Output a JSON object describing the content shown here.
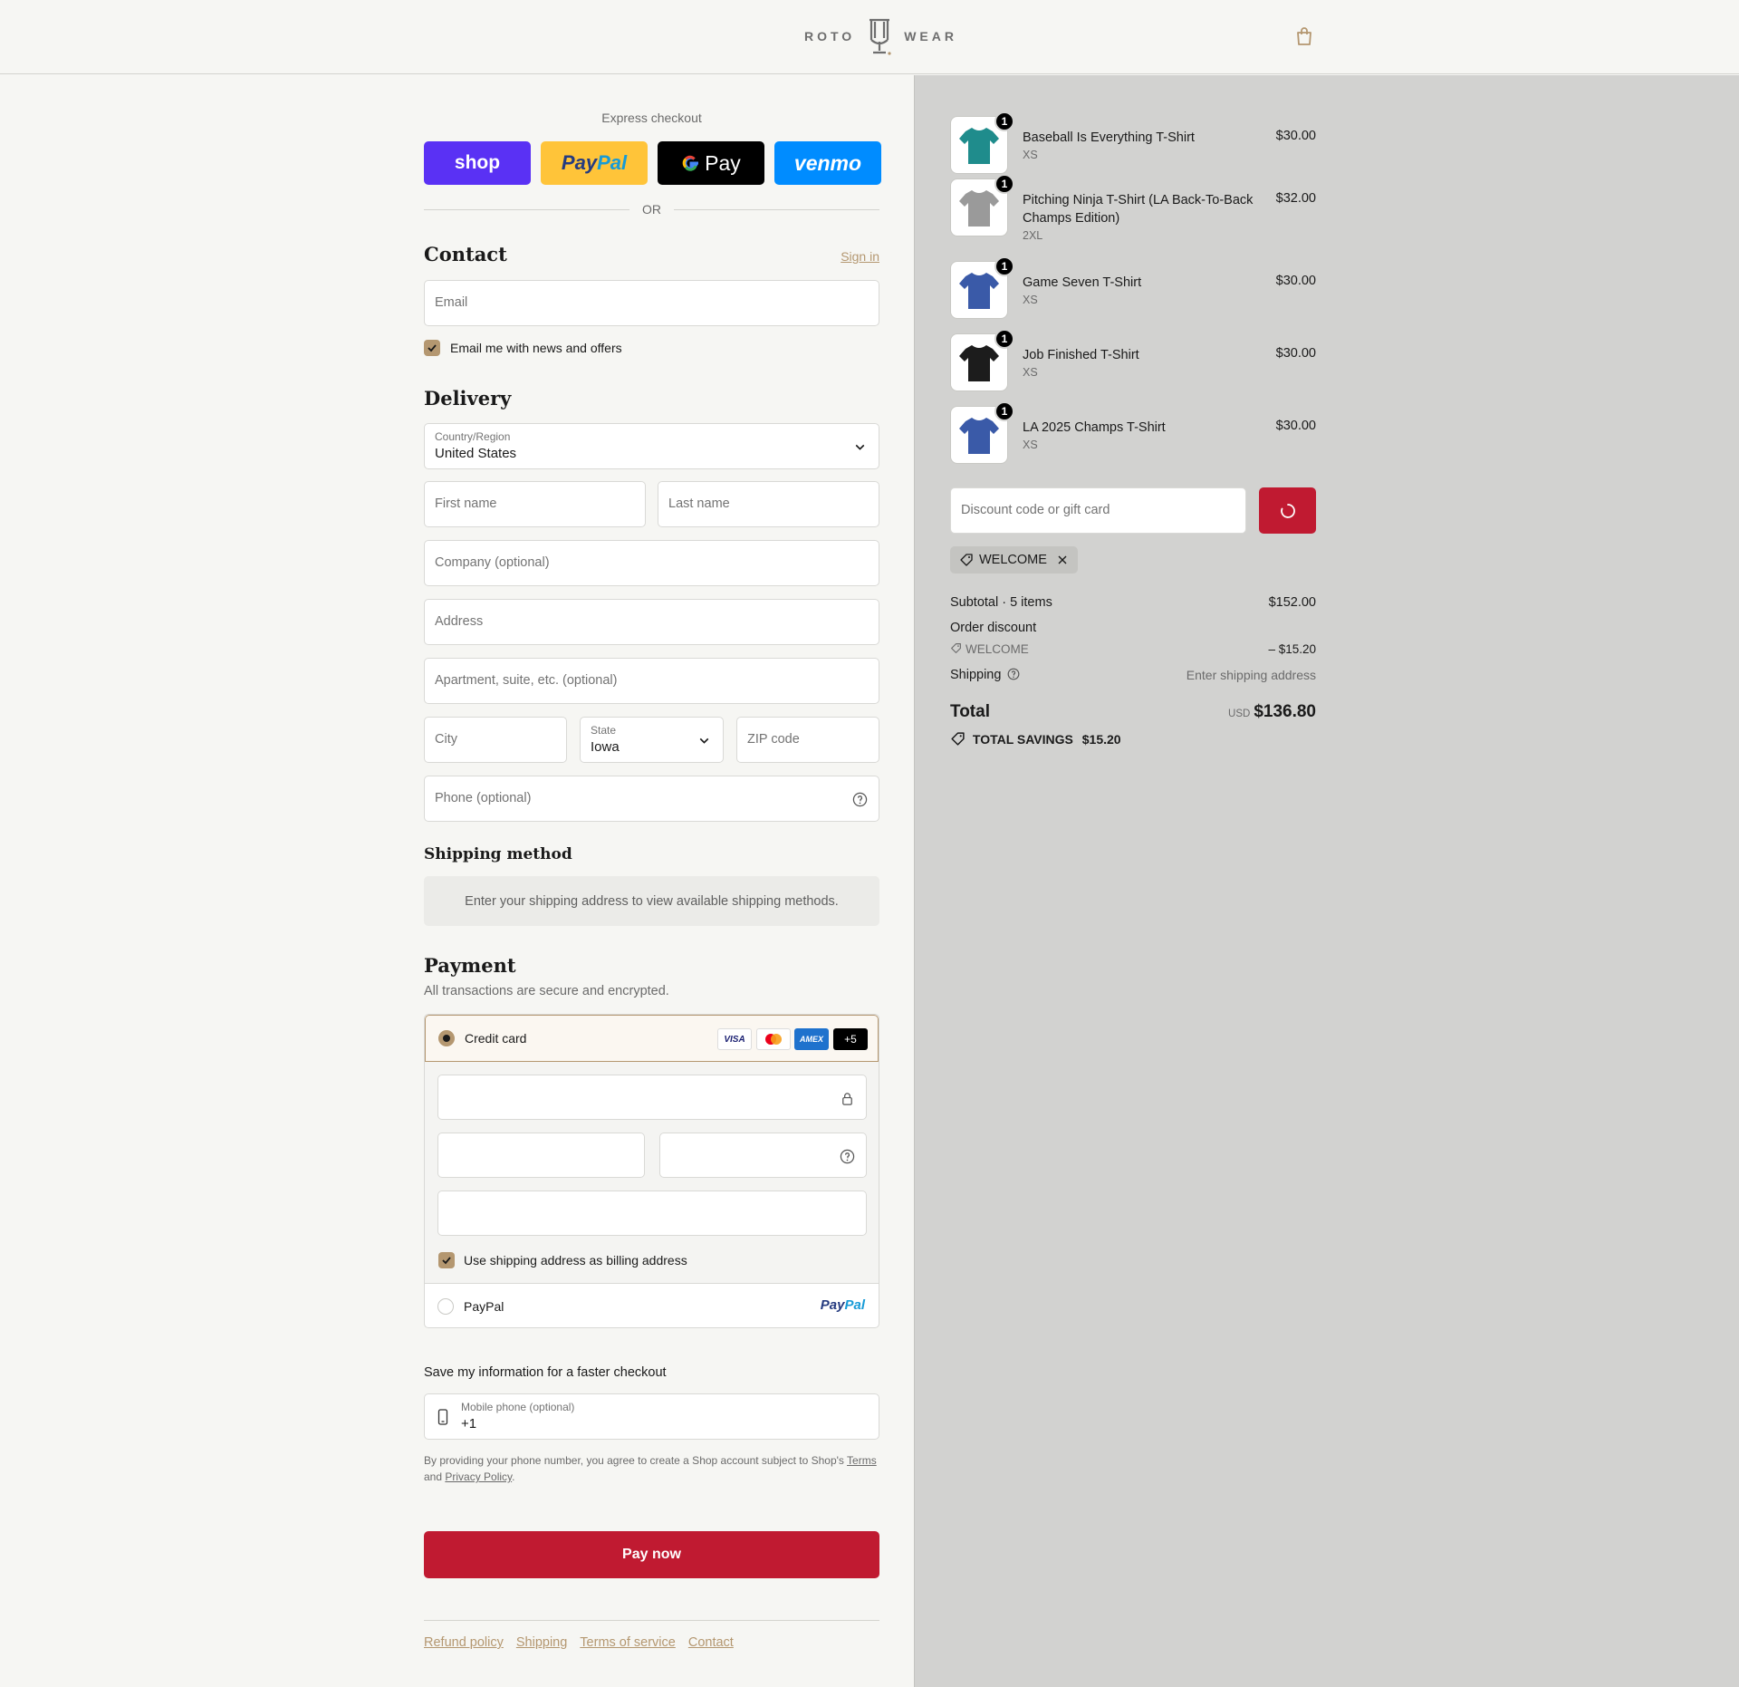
{
  "brand": {
    "left": "ROTO",
    "right": "WEAR",
    "monogram": "RW"
  },
  "express": {
    "title": "Express checkout",
    "buttons": [
      {
        "id": "shop",
        "label": "shop"
      },
      {
        "id": "paypal",
        "label_a": "Pay",
        "label_b": "Pal"
      },
      {
        "id": "gpay",
        "label": "Pay"
      },
      {
        "id": "venmo",
        "label": "venmo"
      }
    ],
    "or": "OR"
  },
  "contact": {
    "title": "Contact",
    "sign_in": "Sign in",
    "email_placeholder": "Email",
    "newsletter_label": "Email me with news and offers",
    "newsletter_checked": true
  },
  "delivery": {
    "title": "Delivery",
    "country_label": "Country/Region",
    "country_value": "United States",
    "first_name": "First name",
    "last_name": "Last name",
    "company": "Company (optional)",
    "address": "Address",
    "apartment": "Apartment, suite, etc. (optional)",
    "city": "City",
    "state_label": "State",
    "state_value": "Iowa",
    "zip": "ZIP code",
    "phone": "Phone (optional)"
  },
  "shipping_method": {
    "title": "Shipping method",
    "notice": "Enter your shipping address to view available shipping methods."
  },
  "payment": {
    "title": "Payment",
    "subtitle": "All transactions are secure and encrypted.",
    "credit_card_label": "Credit card",
    "card_logos": [
      "VISA",
      "",
      "AMEX",
      "+5"
    ],
    "billing_label": "Use shipping address as billing address",
    "billing_checked": true,
    "paypal_label": "PayPal",
    "paypal_logo_a": "Pay",
    "paypal_logo_b": "Pal"
  },
  "save_info": {
    "title": "Save my information for a faster checkout",
    "phone_label": "Mobile phone (optional)",
    "phone_value": "+1",
    "fine_a": "By providing your phone number, you agree to create a Shop account subject to Shop's ",
    "terms": "Terms",
    "fine_b": "and ",
    "privacy": "Privacy Policy",
    "fine_c": "."
  },
  "pay_now": "Pay now",
  "footer": [
    "Refund policy",
    "Shipping",
    "Terms of service",
    "Contact"
  ],
  "summary": {
    "items": [
      {
        "name": "Baseball Is Everything T-Shirt",
        "variant": "XS",
        "price": "$30.00",
        "qty": "1",
        "shirt_color": "#1f8c8c"
      },
      {
        "name": "Pitching Ninja T-Shirt (LA Back-To-Back Champs Edition)",
        "variant": "2XL",
        "price": "$32.00",
        "qty": "1",
        "shirt_color": "#9a9a9a"
      },
      {
        "name": "Game Seven T-Shirt",
        "variant": "XS",
        "price": "$30.00",
        "qty": "1",
        "shirt_color": "#3a5aa8"
      },
      {
        "name": "Job Finished T-Shirt",
        "variant": "XS",
        "price": "$30.00",
        "qty": "1",
        "shirt_color": "#1c1c1c"
      },
      {
        "name": "LA 2025 Champs T-Shirt",
        "variant": "XS",
        "price": "$30.00",
        "qty": "1",
        "shirt_color": "#3a5aa8"
      }
    ],
    "discount_placeholder": "Discount code or gift card",
    "applied_code": "WELCOME",
    "subtotal_label": "Subtotal · 5 items",
    "subtotal_value": "$152.00",
    "order_discount_label": "Order discount",
    "discount_code": "WELCOME",
    "discount_value": "– $15.20",
    "shipping_label": "Shipping",
    "shipping_value": "Enter shipping address",
    "total_label": "Total",
    "currency": "USD",
    "total_value": "$136.80",
    "savings_label": "TOTAL SAVINGS",
    "savings_value": "$15.20"
  },
  "colors": {
    "accent": "#b49770",
    "pay_button": "#c01a31",
    "summary_bg": "#d2d2d0"
  }
}
